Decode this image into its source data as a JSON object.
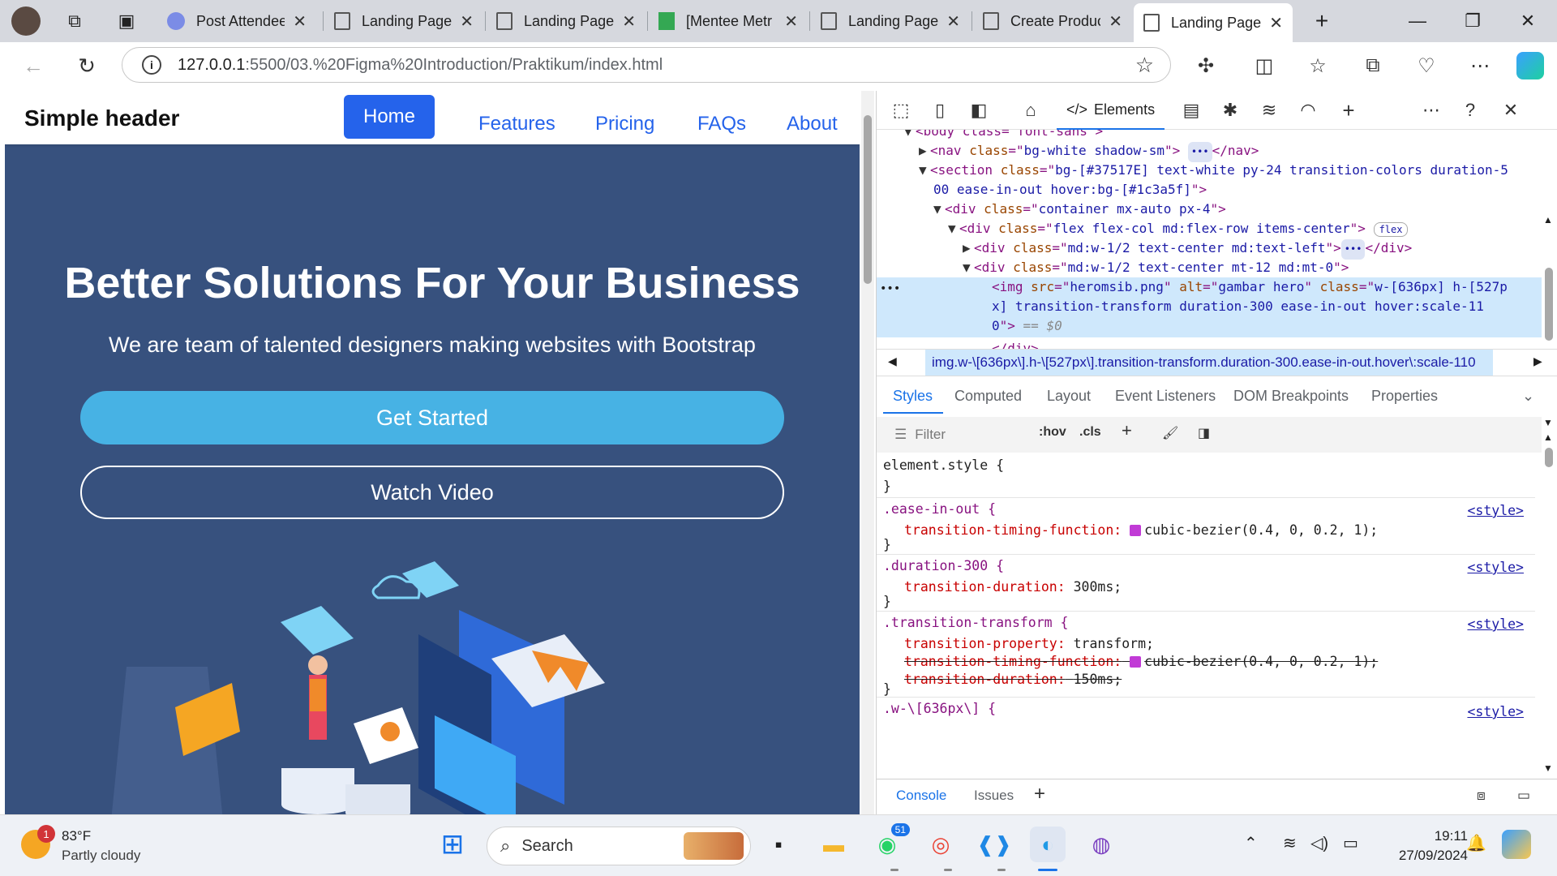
{
  "browser": {
    "tabs": [
      {
        "label": "Post Attendee",
        "icon": "zoom-icon"
      },
      {
        "label": "Landing Page",
        "icon": "page-icon"
      },
      {
        "label": "Landing Page",
        "icon": "page-icon"
      },
      {
        "label": "[Mentee Metr",
        "icon": "sheets-icon"
      },
      {
        "label": "Landing Page",
        "icon": "page-icon"
      },
      {
        "label": "Create Produc",
        "icon": "page-icon"
      },
      {
        "label": "Landing Page",
        "icon": "page-icon",
        "active": true
      }
    ],
    "url_host": "127.0.0.1",
    "url_path": ":5500/03.%20Figma%20Introduction/Praktikum/index.html"
  },
  "site": {
    "brand": "Simple header",
    "nav": [
      "Home",
      "Features",
      "Pricing",
      "FAQs",
      "About"
    ],
    "hero_title": "Better Solutions For Your Business",
    "hero_subtitle": "We are team of talented designers making websites with Bootstrap",
    "cta_primary": "Get Started",
    "cta_secondary": "Watch Video",
    "colors": {
      "hero_bg": "#37517e",
      "accent": "#47b2e4",
      "nav_active": "#2563eb"
    }
  },
  "devtools": {
    "active_tab": "Elements",
    "dom": {
      "body_open": "<body class=\"font-sans\">",
      "nav": {
        "tag": "nav",
        "class": "bg-white shadow-sm"
      },
      "section_class_1": "bg-[#37517E] text-white py-24 transition-colors duration-5",
      "section_class_2": "00 ease-in-out hover:bg-[#1c3a5f]",
      "container_class": "container mx-auto px-4",
      "flex_class": "flex flex-col md:flex-row items-center",
      "flex_badge": "flex",
      "col1_class": "md:w-1/2 text-center md:text-left",
      "col2_class": "md:w-1/2 text-center mt-12 md:mt-0",
      "img_src": "heromsib.png",
      "img_alt": "gambar hero",
      "img_class_1": "w-[636px] h-[527p",
      "img_class_2": "x] transition-transform duration-300 ease-in-out hover:scale-11",
      "img_class_3": "0",
      "img_eq": "== $0",
      "trailing": "</div>"
    },
    "breadcrumb": "img.w-\\[636px\\].h-\\[527px\\].transition-transform.duration-300.ease-in-out.hover\\:scale-110",
    "style_tabs": [
      "Styles",
      "Computed",
      "Layout",
      "Event Listeners",
      "DOM Breakpoints",
      "Properties"
    ],
    "filter_placeholder": "Filter",
    "filter_tools": [
      ":hov",
      ".cls"
    ],
    "rules": {
      "element_style": "element.style {",
      "ease_sel": ".ease-in-out {",
      "ease_prop": "transition-timing-function:",
      "ease_val": "cubic-bezier(0.4, 0, 0.2, 1);",
      "dur_sel": ".duration-300 {",
      "dur_prop": "transition-duration:",
      "dur_val": "300ms;",
      "tt_sel": ".transition-transform {",
      "tt_prop1": "transition-property:",
      "tt_val1": "transform;",
      "tt_prop2": "transition-timing-function:",
      "tt_val2": "cubic-bezier(0.4, 0, 0.2, 1);",
      "tt_prop3": "transition-duration:",
      "tt_val3": "150ms;",
      "w_sel": ".w-\\[636px\\] {",
      "close": "}",
      "source": "<style>"
    },
    "drawer_tabs": [
      "Console",
      "Issues"
    ]
  },
  "taskbar": {
    "weather_temp": "83°F",
    "weather_desc": "Partly cloudy",
    "weather_badge": "1",
    "search_label": "Search",
    "whatsapp_badge": "51",
    "time": "19:11",
    "date": "27/09/2024"
  }
}
